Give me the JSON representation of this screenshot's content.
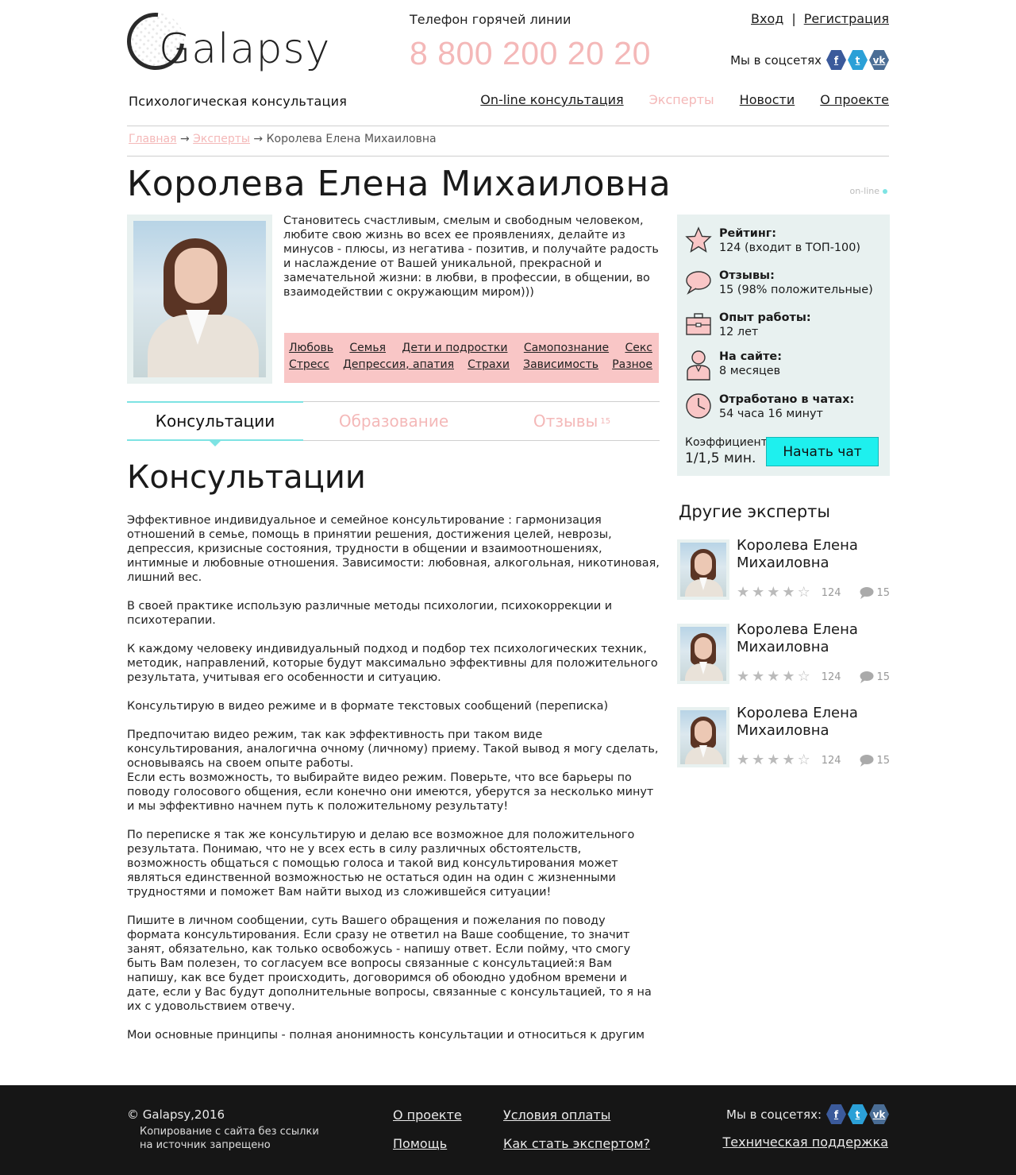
{
  "header": {
    "brand": "Galapsy",
    "tagline": "Психологическая консультация",
    "hotline_label": "Телефон горячей линии",
    "hotline_number": "8 800 200 20 20",
    "login": "Вход",
    "separator": "|",
    "register": "Регистрация",
    "social_label": "Мы в соцсетях",
    "nav": [
      "On-line консультация",
      "Эксперты",
      "Новости",
      "О проекте"
    ]
  },
  "breadcrumb": {
    "home": "Главная",
    "experts": "Эксперты",
    "arrow": "→",
    "current": "Королева Елена Михаиловна"
  },
  "profile": {
    "name": "Королева Елена Михаиловна",
    "status": "on-line",
    "bio": "Становитесь счастливым, смелым и свободным человеком, любите свою жизнь во всех ее проявлениях, делайте из минусов - плюсы, из негатива - позитив, и получайте радость и наслаждение от Вашей уникальной, прекрасной и замечательной жизни: в любви, в профессии, в общении, во взаимодействии с окружающим миром)))",
    "tags_row1": [
      "Любовь",
      "Семья",
      "Дети и подростки",
      "Самопознание",
      "Секс"
    ],
    "tags_row2": [
      "Стресс",
      "Депрессия, апатия",
      "Страхи",
      "Зависимость",
      "Разное"
    ]
  },
  "tabs": {
    "consult": "Консультации",
    "education": "Образование",
    "reviews": "Отзывы",
    "reviews_count": "15"
  },
  "section_title": "Консультации",
  "content": [
    "Эффективное индивидуальное и семейное консультирование : гармонизация отношений в семье, помощь в принятии решения, достижения целей, неврозы, депрессия, кризисные состояния, трудности в общении и взаимоотношениях, интимные и любовные отношения. Зависимости: любовная, алкогольная, никотиновая, лишний вес.",
    "В своей практике использую различные методы психологии, психокоррекции и психотерапии.",
    "К каждому человеку индивидуальный подход и подбор тех психологических техник, методик, направлений, которые будут максимально эффективны для положительного результата, учитывая его особенности и ситуацию.",
    "Консультирую в видео режиме и в формате текстовых сообщений (переписка)",
    "Предпочитаю видео режим, так как эффективность при таком виде консультирования, аналогична очному (личному) приему. Такой вывод я могу сделать, основываясь на своем опыте работы.\nЕсли есть возможность, то выбирайте видео режим. Поверьте, что все барьеры по поводу голосового общения, если конечно они имеются, уберутся за несколько минут и мы эффективно начнем путь к положительному результату!",
    "По переписке я так же консультирую и делаю все возможное для положительного результата. Понимаю, что не у всех есть в силу различных обстоятельств, возможность общаться с помощью голоса и такой вид консультирования может являться единственной возможностью не остаться один на один с жизненными трудностями и поможет Вам найти выход из сложившейся ситуации!",
    "Пишите в личном сообщении, суть Вашего обращения и пожелания по поводу формата консультирования. Если сразу не ответил на Ваше сообщение, то значит занят, обязательно, как только освобожусь - напишу ответ. Если пойму, что смогу быть Вам полезен, то согласуем все вопросы связанные с консультацией:я Вам напишу, как все будет происходить, договоримся об обоюдно удобном времени и дате, если у Вас будут дополнительные вопросы, связанные с консультацией, то я на их с удовольствием отвечу.",
    "Мои основные принципы - полная анонимность консультации и относиться к другим так, как хочешь, что бы относились к тебе. При желании человека и грамотном подходе"
  ],
  "stats": {
    "rating_label": "Рейтинг:",
    "rating_value": "124 (входит в ТОП-100)",
    "reviews_label": "Отзывы:",
    "reviews_value": "15 (98% положительные)",
    "experience_label": "Опыт работы:",
    "experience_value": "12 лет",
    "onsite_label": "На сайте:",
    "onsite_value": "8 месяцев",
    "chat_label": "Отработано в чатах:",
    "chat_value": "54 часа 16 минут",
    "coef_label": "Коэффициент:",
    "coef_value": "1/1,5 мин.",
    "start_chat": "Начать чат"
  },
  "others": {
    "title": "Другие эксперты",
    "items": [
      {
        "name": "Королева Елена Михаиловна",
        "stars": 4,
        "rating": "124",
        "reviews": "15"
      },
      {
        "name": "Королева Елена Михаиловна",
        "stars": 4,
        "rating": "124",
        "reviews": "15"
      },
      {
        "name": "Королева Елена Михаиловна",
        "stars": 4,
        "rating": "124",
        "reviews": "15"
      }
    ]
  },
  "footer": {
    "copyright": "© Galapsy,2016",
    "note": "Копирование с сайта без ссылки на источник запрещено",
    "about": "О проекте",
    "help": "Помощь",
    "payment": "Условия оплаты",
    "become": "Как стать экспертом?",
    "social_label": "Мы в соцсетях:",
    "support": "Техническая поддержка"
  },
  "colors": {
    "accent_pink": "#f4b8b8",
    "tag_bg": "#f9c6c6",
    "accent_cyan": "#1ef0ee",
    "panel_bg": "#e8f1f0",
    "footer_bg": "#161616"
  }
}
